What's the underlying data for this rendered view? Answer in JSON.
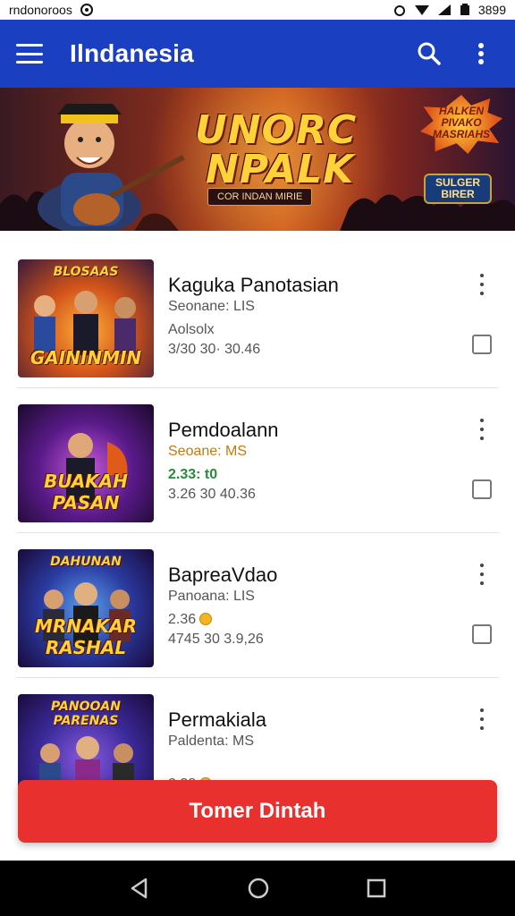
{
  "status_bar": {
    "left_text": "rndonoroos",
    "right_text": "3899"
  },
  "app_bar": {
    "title": "Ilndanesia"
  },
  "banner": {
    "title_line1": "UNORC",
    "title_line2": "NPALK",
    "subtitle": "COR INDAN MIRIE",
    "badge_top": "HALKEN PIVAKO MASRIAHS",
    "badge_bottom": "SULGER BIRER"
  },
  "items": [
    {
      "title": "Kaguka Panotasian",
      "line1": "Seonane: LIS",
      "line2": "Aolsolx",
      "line3": "3/30 30·  30.46",
      "thumb_top": "BLOSAAS",
      "thumb_text": "GAININMIN",
      "checked": false
    },
    {
      "title": "Pemdoalann",
      "line1": "Seoane: MS",
      "line2": "2.33: t0",
      "line3": "3.26 30   40.36",
      "thumb_top": "",
      "thumb_text": "BUAKAH PASAN",
      "checked": false
    },
    {
      "title": "BapreaVdao",
      "line1": "Panoana: LIS",
      "line2": "2.36",
      "line3": "4745 30   3.9,26",
      "thumb_top": "DAHUNAN",
      "thumb_text": "MRNAKAR RASHAL",
      "checked": false
    },
    {
      "title": "Permakiala",
      "line1": "Paldenta: MS",
      "line2": "2.38",
      "line3": "",
      "thumb_top": "PANOOAN PARENAS",
      "thumb_text": "",
      "checked": false
    }
  ],
  "cta": {
    "label": "Tomer Dintah"
  },
  "colors": {
    "app_bar": "#1a3fc0",
    "cta": "#e8312f",
    "nav": "#000000"
  },
  "icons": [
    "menu-icon",
    "search-icon",
    "more-vert-icon",
    "back-icon",
    "home-icon",
    "recents-icon"
  ]
}
